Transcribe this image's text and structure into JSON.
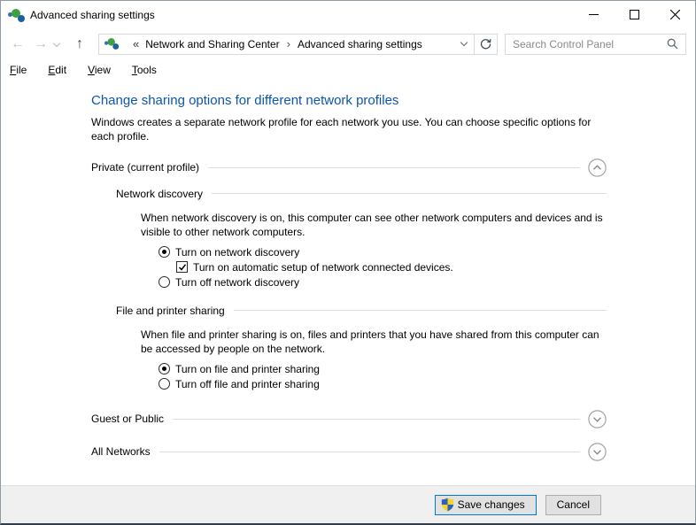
{
  "titlebar": {
    "title": "Advanced sharing settings"
  },
  "navbar": {
    "breadcrumb": {
      "prefix": "«",
      "separator": "›",
      "items": [
        "Network and Sharing Center",
        "Advanced sharing settings"
      ]
    },
    "search": {
      "placeholder": "Search Control Panel",
      "value": ""
    }
  },
  "icons": {
    "back": "←",
    "forward": "→",
    "up": "↑"
  },
  "menubar": {
    "items": [
      "File",
      "Edit",
      "View",
      "Tools"
    ]
  },
  "content": {
    "heading": "Change sharing options for different network profiles",
    "intro": "Windows creates a separate network profile for each network you use. You can choose specific options for each profile.",
    "private": {
      "title": "Private (current profile)",
      "state": "expanded",
      "network_discovery": {
        "title": "Network discovery",
        "description": "When network discovery is on, this computer can see other network computers and devices and is visible to other network computers.",
        "radio_on": "Turn on network discovery",
        "radio_on_selected": true,
        "checkbox": "Turn on automatic setup of network connected devices.",
        "checkbox_checked": true,
        "radio_off": "Turn off network discovery",
        "radio_off_selected": false
      },
      "file_printer": {
        "title": "File and printer sharing",
        "description": "When file and printer sharing is on, files and printers that you have shared from this computer can be accessed by people on the network.",
        "radio_on": "Turn on file and printer sharing",
        "radio_on_selected": true,
        "radio_off": "Turn off file and printer sharing",
        "radio_off_selected": false
      }
    },
    "guest": {
      "title": "Guest or Public",
      "state": "collapsed"
    },
    "all_networks": {
      "title": "All Networks",
      "state": "collapsed"
    }
  },
  "footer": {
    "save_label": "Save changes",
    "cancel_label": "Cancel"
  },
  "colors": {
    "heading": "#0d55aa",
    "accent": "#0078d7",
    "line": "#dcdcdc",
    "footer_bg": "#f0f0f0"
  }
}
